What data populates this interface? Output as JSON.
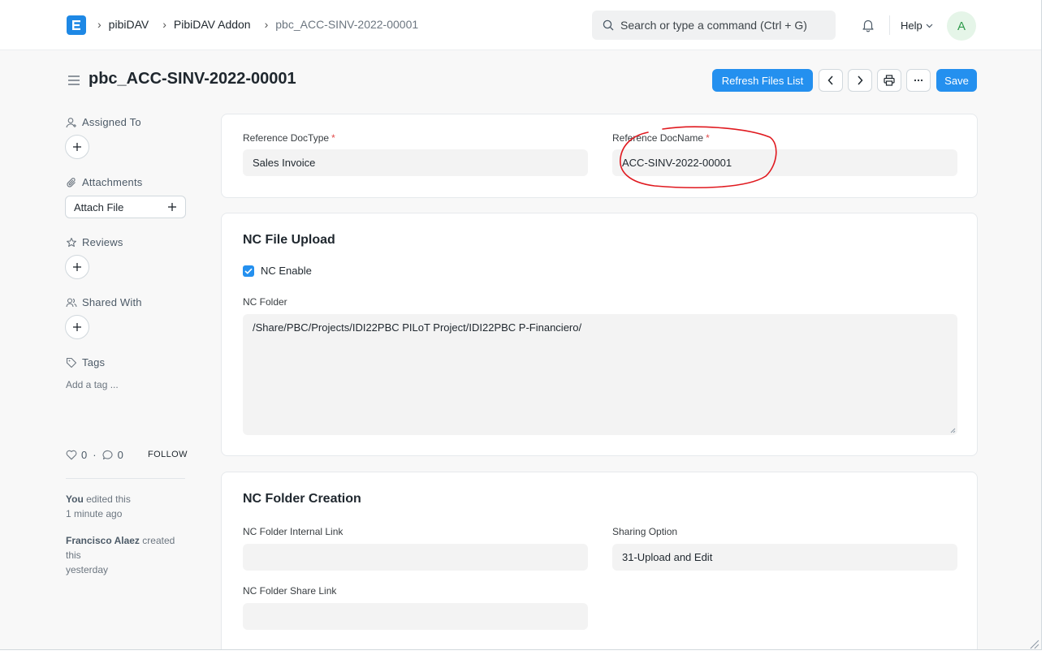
{
  "navbar": {
    "breadcrumbs": [
      "pibiDAV",
      "PibiDAV Addon",
      "pbc_ACC-SINV-2022-00001"
    ],
    "search_placeholder": "Search or type a command (Ctrl + G)",
    "help_label": "Help",
    "avatar_initial": "A"
  },
  "page": {
    "title": "pbc_ACC-SINV-2022-00001",
    "refresh_label": "Refresh Files List",
    "save_label": "Save"
  },
  "sidebar": {
    "assigned_to": "Assigned To",
    "attachments": "Attachments",
    "attach_file": "Attach File",
    "reviews": "Reviews",
    "shared_with": "Shared With",
    "tags": "Tags",
    "add_tag": "Add a tag ...",
    "likes": "0",
    "comments": "0",
    "follow": "FOLLOW",
    "activity": [
      {
        "actor": "You",
        "action": " edited this",
        "when": "1 minute ago"
      },
      {
        "actor": "Francisco Alaez",
        "action": " created this",
        "when": "yesterday"
      }
    ]
  },
  "form": {
    "reference": {
      "doctype_label": "Reference DocType",
      "doctype_value": "Sales Invoice",
      "docname_label": "Reference DocName",
      "docname_value": "ACC-SINV-2022-00001",
      "required_mark": "*"
    },
    "nc_upload": {
      "title": "NC File Upload",
      "enable_label": "NC Enable",
      "enable_checked": true,
      "folder_label": "NC Folder",
      "folder_value": "/Share/PBC/Projects/IDI22PBC PILoT Project/IDI22PBC P-Financiero/"
    },
    "nc_creation": {
      "title": "NC Folder Creation",
      "internal_link_label": "NC Folder Internal Link",
      "internal_link_value": "",
      "sharing_option_label": "Sharing Option",
      "sharing_option_value": "31-Upload and Edit",
      "share_link_label": "NC Folder Share Link",
      "share_link_value": ""
    }
  },
  "colors": {
    "primary": "#2490ef",
    "annotation": "#e0191f",
    "avatar_bg": "#e5f5e8",
    "avatar_fg": "#2e9a4b"
  }
}
